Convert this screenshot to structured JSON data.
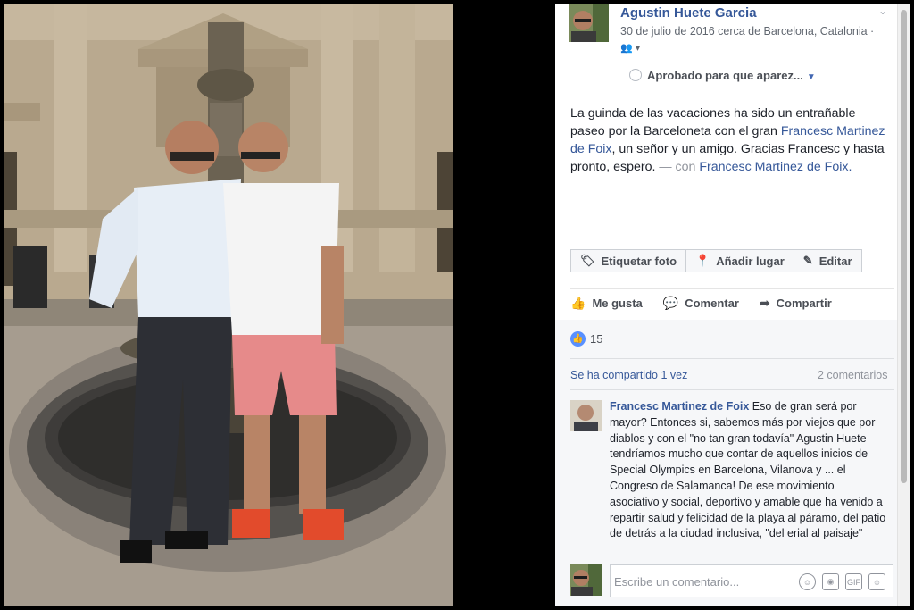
{
  "post": {
    "author": "Agustin Huete Garcia",
    "meta": "30 de julio de 2016 cerca de Barcelona, Catalonia ·",
    "approval": "Aprobado para que aparez...",
    "caption_1": "La guinda de las vacaciones ha sido un entrañable paseo por la Barceloneta con el gran ",
    "caption_link_1": "Francesc Martinez de Foix",
    "caption_2": ", un señor y un amigo. Gracias Francesc y hasta pronto, espero. ",
    "caption_con": "— con ",
    "caption_link_2": "Francesc Martinez de Foix."
  },
  "buttons": {
    "tag": "Etiquetar foto",
    "place": "Añadir lugar",
    "edit": "Editar"
  },
  "actions": {
    "like": "Me gusta",
    "comment": "Comentar",
    "share": "Compartir"
  },
  "stats": {
    "likes": "15",
    "shared": "Se ha compartido 1 vez",
    "comments": "2 comentarios"
  },
  "comment": {
    "author": "Francesc Martinez de Foix",
    "text": " Eso de gran será por mayor? Entonces si, sabemos más por viejos que por diablos y con el \"no tan gran todavía\" Agustin Huete tendríamos mucho que contar de aquellos inicios de Special Olympics en Barcelona, Vilanova y ... el Congreso de Salamanca! De ese movimiento asociativo y social, deportivo y amable que ha venido a repartir salud y felicidad de la playa al páramo, del patio de detrás a la ciudad inclusiva, \"del erial al paisaje\""
  },
  "composer": {
    "placeholder": "Escribe un comentario..."
  },
  "icons": [
    "privacy-friends-icon",
    "chevron-down-icon",
    "tag-icon",
    "location-pin-icon",
    "pencil-icon",
    "thumbs-up-icon",
    "comment-icon",
    "share-arrow-icon",
    "emoji-icon",
    "camera-icon",
    "gif-icon",
    "sticker-icon"
  ],
  "colors": {
    "link": "#365899",
    "like_blue": "#5890ff"
  }
}
